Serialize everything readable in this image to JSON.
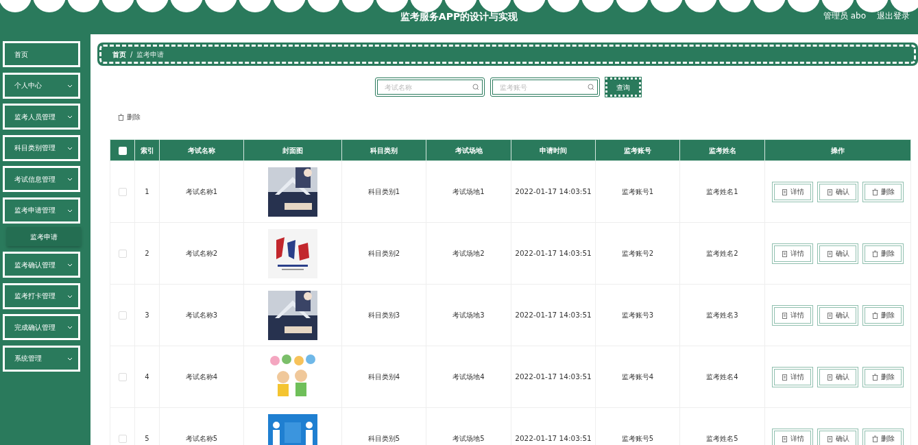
{
  "header": {
    "title": "监考服务APP的设计与实现",
    "user": "管理员 abo",
    "logout": "退出登录"
  },
  "sidebar": {
    "items": [
      {
        "label": "首页",
        "has_arrow": false
      },
      {
        "label": "个人中心",
        "has_arrow": true
      },
      {
        "label": "监考人员管理",
        "has_arrow": true
      },
      {
        "label": "科目类别管理",
        "has_arrow": true
      },
      {
        "label": "考试信息管理",
        "has_arrow": true
      },
      {
        "label": "监考申请管理",
        "has_arrow": true,
        "children": [
          {
            "label": "监考申请"
          }
        ]
      },
      {
        "label": "监考确认管理",
        "has_arrow": true
      },
      {
        "label": "监考打卡管理",
        "has_arrow": true
      },
      {
        "label": "完成确认管理",
        "has_arrow": true
      },
      {
        "label": "系统管理",
        "has_arrow": true
      }
    ]
  },
  "breadcrumb": {
    "items": [
      "首页",
      "监考申请"
    ],
    "separator": "/"
  },
  "search": {
    "fields": [
      {
        "placeholder": "考试名称"
      },
      {
        "placeholder": "监考账号"
      }
    ],
    "button": "查询"
  },
  "bulk_delete": "删除",
  "table": {
    "columns": [
      "索引",
      "考试名称",
      "封面图",
      "科目类别",
      "考试场地",
      "申请时间",
      "监考账号",
      "监考姓名",
      "操作"
    ],
    "header_checked": false,
    "rows": [
      {
        "checked": false,
        "index": "1",
        "name": "考试名称1",
        "category": "科目类别1",
        "place": "考试场地1",
        "time": "2022-01-17 14:03:51",
        "account": "监考账号1",
        "person": "监考姓名1",
        "actions": [
          "详情",
          "确认",
          "删除"
        ]
      },
      {
        "checked": false,
        "index": "2",
        "name": "考试名称2",
        "category": "科目类别2",
        "place": "考试场地2",
        "time": "2022-01-17 14:03:51",
        "account": "监考账号2",
        "person": "监考姓名2",
        "actions": [
          "详情",
          "确认",
          "删除"
        ]
      },
      {
        "checked": false,
        "index": "3",
        "name": "考试名称3",
        "category": "科目类别3",
        "place": "考试场地3",
        "time": "2022-01-17 14:03:51",
        "account": "监考账号3",
        "person": "监考姓名3",
        "actions": [
          "详情",
          "确认",
          "删除"
        ]
      },
      {
        "checked": false,
        "index": "4",
        "name": "考试名称4",
        "category": "科目类别4",
        "place": "考试场地4",
        "time": "2022-01-17 14:03:51",
        "account": "监考账号4",
        "person": "监考姓名4",
        "actions": [
          "详情",
          "确认",
          "删除"
        ]
      },
      {
        "checked": false,
        "index": "5",
        "name": "考试名称5",
        "category": "科目类别5",
        "place": "考试场地5",
        "time": "2022-01-17 14:03:51",
        "account": "监考账号5",
        "person": "监考姓名5",
        "actions": [
          "详情",
          "确认",
          "删除"
        ]
      }
    ]
  }
}
